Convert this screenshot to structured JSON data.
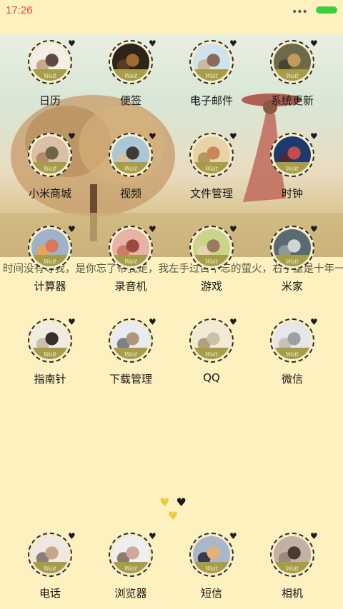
{
  "status_bar": {
    "time": "17:26",
    "more_dots": "•••",
    "battery_color": "#3ecf3e"
  },
  "quote_text": "时间没有等我，是你忘了带我走，我左手过目不忘的萤火，右手里是十年一个漫长的打坐。",
  "rows": [
    [
      {
        "label": "日历",
        "name": "app-calendar",
        "scene": [
          "#f3efe6",
          "#5e4b3f",
          "#c9a892"
        ]
      },
      {
        "label": "便签",
        "name": "app-notes",
        "scene": [
          "#2c2418",
          "#a16a2e",
          "#5a3a22"
        ]
      },
      {
        "label": "电子邮件",
        "name": "app-email",
        "scene": [
          "#cfe3ee",
          "#8a6a58",
          "#c9b8a0"
        ]
      },
      {
        "label": "系统更新",
        "name": "app-system-update",
        "scene": [
          "#6d6a4a",
          "#c59b5b",
          "#4b4330"
        ]
      }
    ],
    [
      {
        "label": "小米商城",
        "name": "app-mi-store",
        "scene": [
          "#d9c0a6",
          "#6d6548",
          "#b38b6a"
        ]
      },
      {
        "label": "视频",
        "name": "app-video",
        "scene": [
          "#a9c7d6",
          "#3e3a34",
          "#d3c2a2"
        ]
      },
      {
        "label": "文件管理",
        "name": "app-file-manager",
        "scene": [
          "#e8d3a6",
          "#c98757",
          "#b59763"
        ]
      },
      {
        "label": "时钟",
        "name": "app-clock",
        "scene": [
          "#1b3b6f",
          "#c34b4b",
          "#4a2a3a"
        ]
      }
    ],
    [
      {
        "label": "计算器",
        "name": "app-calculator",
        "scene": [
          "#9cb3c9",
          "#d9785a",
          "#e9a262"
        ]
      },
      {
        "label": "录音机",
        "name": "app-recorder",
        "scene": [
          "#e7b3a6",
          "#9b4a3f",
          "#d07a6b"
        ]
      },
      {
        "label": "游戏",
        "name": "app-games",
        "scene": [
          "#c9d68a",
          "#9b7a62",
          "#e7d2b2"
        ]
      },
      {
        "label": "米家",
        "name": "app-mijia",
        "scene": [
          "#5a6a72",
          "#d2d6d2",
          "#8a9a9e"
        ]
      }
    ],
    [
      {
        "label": "指南针",
        "name": "app-compass",
        "scene": [
          "#f1ece2",
          "#3a2e2a",
          "#cdbfb0"
        ]
      },
      {
        "label": "下载管理",
        "name": "app-download-manager",
        "scene": [
          "#e9ecef",
          "#b2967a",
          "#7b7f88"
        ]
      },
      {
        "label": "QQ",
        "name": "app-qq",
        "scene": [
          "#f3ead6",
          "#c8c3a8",
          "#b3a17e"
        ]
      },
      {
        "label": "微信",
        "name": "app-wechat",
        "scene": [
          "#e6e7ea",
          "#9aa0a6",
          "#c6c2b8"
        ]
      }
    ]
  ],
  "dock": [
    {
      "label": "电话",
      "name": "app-phone",
      "scene": [
        "#f0e8e0",
        "#c9a68a",
        "#8a7f78"
      ]
    },
    {
      "label": "浏览器",
      "name": "app-browser",
      "scene": [
        "#eef0ef",
        "#d0a89a",
        "#8b7c6e"
      ]
    },
    {
      "label": "短信",
      "name": "app-messages",
      "scene": [
        "#a9b8c8",
        "#e7b07a",
        "#3a3a48"
      ]
    },
    {
      "label": "相机",
      "name": "app-camera",
      "scene": [
        "#c3b1a4",
        "#4b3a34",
        "#9e8a7e"
      ]
    }
  ],
  "wait_text": "Wait",
  "pager": {
    "dots": [
      "♥",
      "♥",
      "♥"
    ],
    "active_index": 1,
    "active_color": "#1c1c1c",
    "inactive_color": "#f0c93a"
  }
}
